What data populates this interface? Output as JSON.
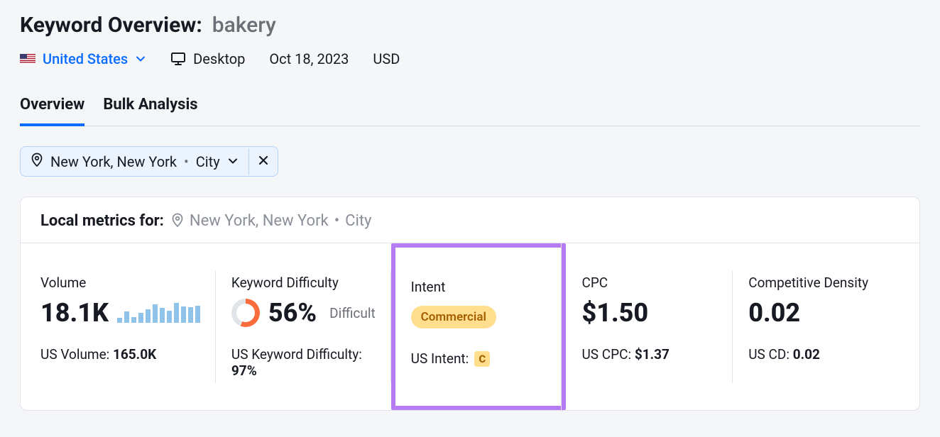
{
  "header": {
    "title_prefix": "Keyword Overview:",
    "keyword": "bakery",
    "country": "United States",
    "device": "Desktop",
    "date": "Oct 18, 2023",
    "currency": "USD"
  },
  "tabs": {
    "overview": "Overview",
    "bulk": "Bulk Analysis"
  },
  "filter": {
    "location_name": "New York, New York",
    "location_type": "City"
  },
  "panel": {
    "lead": "Local metrics for:",
    "location_name": "New York, New York",
    "location_type": "City"
  },
  "metrics": {
    "volume": {
      "label": "Volume",
      "value": "18.1K",
      "sub_label": "US Volume:",
      "sub_value": "165.0K",
      "bars": [
        6,
        14,
        7,
        12,
        16,
        22,
        18,
        15,
        24,
        20,
        19,
        21
      ]
    },
    "kd": {
      "label": "Keyword Difficulty",
      "value": "56%",
      "value_label": "Difficult",
      "sub_label": "US Keyword Difficulty:",
      "sub_value": "97%"
    },
    "intent": {
      "label": "Intent",
      "value": "Commercial",
      "sub_label": "US Intent:",
      "sub_badge": "C"
    },
    "cpc": {
      "label": "CPC",
      "value": "$1.50",
      "sub_label": "US CPC:",
      "sub_value": "$1.37"
    },
    "cd": {
      "label": "Competitive Density",
      "value": "0.02",
      "sub_label": "US CD:",
      "sub_value": "0.02"
    }
  }
}
